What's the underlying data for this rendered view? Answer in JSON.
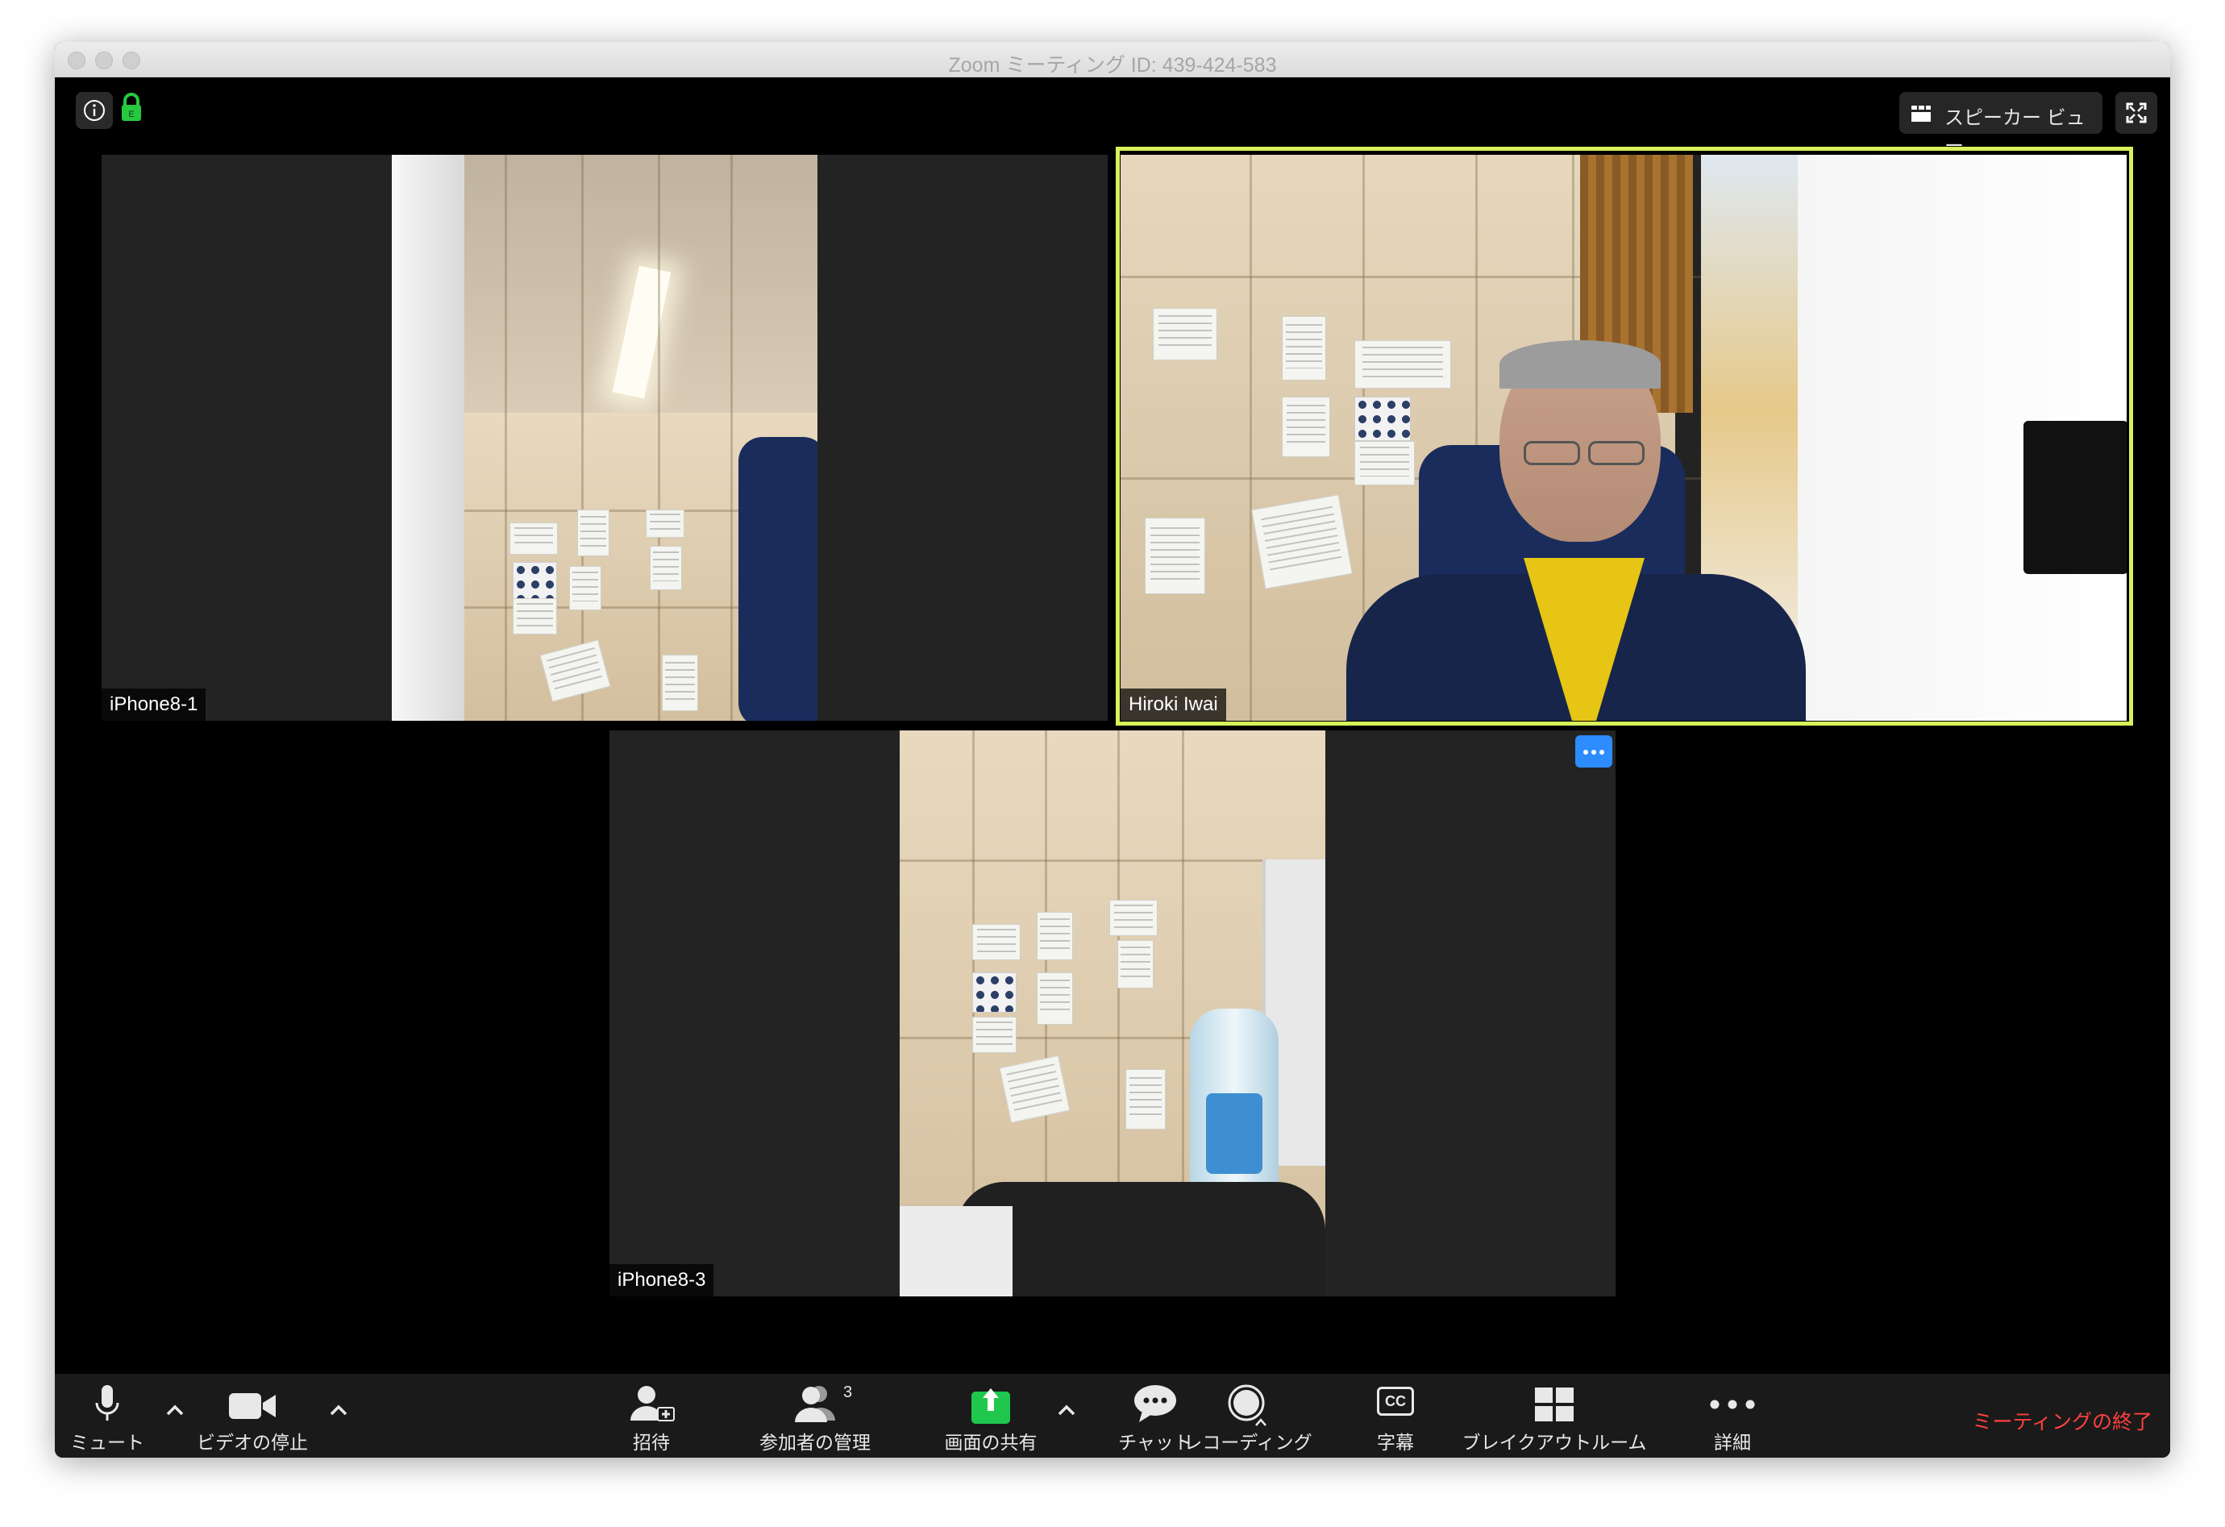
{
  "window": {
    "title": "Zoom ミーティング ID: 439-424-583"
  },
  "top_bar": {
    "view_label": "スピーカー ビュー"
  },
  "participants": [
    {
      "name": "iPhone8-1"
    },
    {
      "name": "Hiroki Iwai"
    },
    {
      "name": "iPhone8-3"
    }
  ],
  "toolbar": {
    "mute_label": "ミュート",
    "video_label": "ビデオの停止",
    "invite_label": "招待",
    "participants_label": "参加者の管理",
    "participants_count": "3",
    "share_label": "画面の共有",
    "chat_label": "チャット",
    "record_label": "レコーディング",
    "captions_label": "字幕",
    "captions_icon_text": "CC",
    "breakout_label": "ブレイクアウトルーム",
    "more_label": "詳細",
    "end_label": "ミーティングの終了"
  },
  "colors": {
    "active_speaker_border": "#d7f25a",
    "share_green": "#1fc74d",
    "end_red": "#ff4040",
    "more_button_blue": "#2d8cff"
  }
}
